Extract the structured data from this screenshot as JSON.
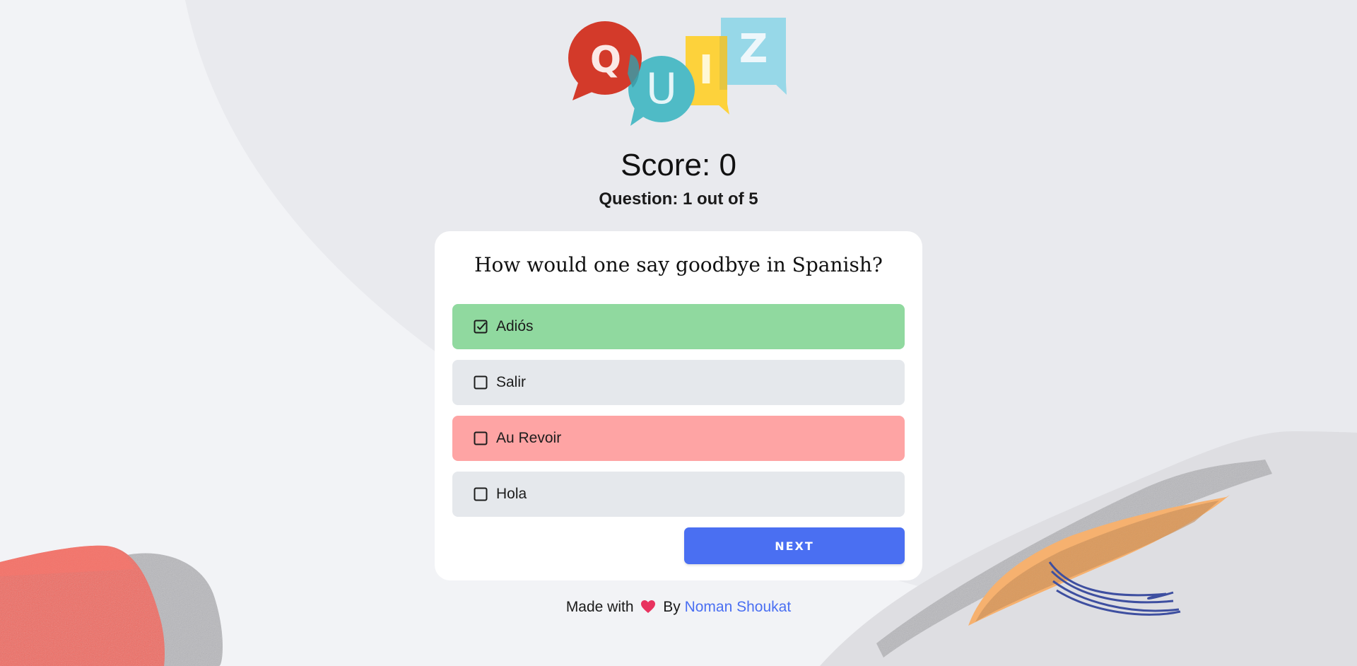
{
  "score": {
    "label": "Score: 0"
  },
  "progress": {
    "label": "Question: 1 out of 5"
  },
  "question": {
    "text": "How would one say goodbye in Spanish?"
  },
  "answers": [
    {
      "label": "Adiós",
      "state": "correct",
      "checked": true
    },
    {
      "label": "Salir",
      "state": "neutral",
      "checked": false
    },
    {
      "label": "Au Revoir",
      "state": "wrong",
      "checked": false
    },
    {
      "label": "Hola",
      "state": "neutral",
      "checked": false
    }
  ],
  "next_button": {
    "label": "NEXT"
  },
  "footer": {
    "made_with": "Made with",
    "by": "By",
    "author": "Noman Shoukat",
    "heart_icon": "heart-icon"
  },
  "logo": {
    "letters": [
      "Q",
      "U",
      "I",
      "Z"
    ]
  },
  "colors": {
    "correct": "#90d99f",
    "wrong": "#fea4a4",
    "neutral": "#e5e8ec",
    "accent": "#4a6ff2",
    "heart": "#e8335f"
  }
}
